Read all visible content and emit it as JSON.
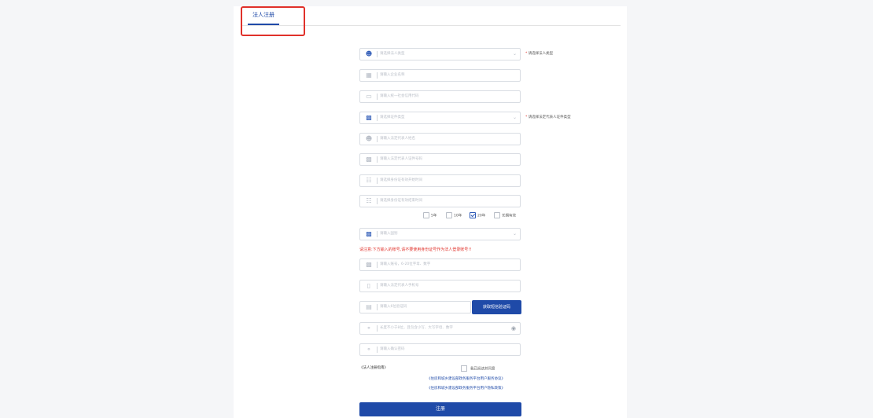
{
  "tab": {
    "label": "法人注册"
  },
  "fields": [
    {
      "placeholder": "请选择法人类型",
      "icon": "user-icon",
      "dropdown": true,
      "hint_req": "*",
      "hint": "请选择法人类型"
    },
    {
      "placeholder": "请输入企业名称",
      "icon": "building-icon"
    },
    {
      "placeholder": "请输入统一社会信用代码",
      "icon": "credit-card-icon"
    },
    {
      "placeholder": "请选择证件类型",
      "icon": "id-card-icon",
      "dropdown": true,
      "hint_req": "*",
      "hint": "请选择法定代表人证件类型"
    },
    {
      "placeholder": "请输入法定代表人姓名",
      "icon": "user-icon"
    },
    {
      "placeholder": "请输入法定代表人证件号码",
      "icon": "id-card-icon"
    },
    {
      "placeholder": "请选择身份证有效开始时间",
      "icon": "calendar-icon"
    },
    {
      "placeholder": "请选择身份证有效结束时间",
      "icon": "calendar-icon"
    }
  ],
  "validity_options": [
    {
      "label": "5年",
      "checked": false
    },
    {
      "label": "10年",
      "checked": false
    },
    {
      "label": "20年",
      "checked": true
    },
    {
      "label": "长期有效",
      "checked": false
    }
  ],
  "nationality": {
    "placeholder": "请输入国别",
    "icon": "id-card-icon"
  },
  "warning": "请注意:下方输入的账号,请不要使用身份证号作为法人登录账号!!",
  "account": {
    "placeholder": "请输入账号，6-20位字母、数字",
    "icon": "id-card-icon"
  },
  "phone": {
    "placeholder": "请输入法定代表人手机号",
    "icon": "phone-icon"
  },
  "sms": {
    "placeholder": "请输入6位验证码",
    "icon": "message-icon",
    "button": "获取短信验证码"
  },
  "password": {
    "placeholder": "长度不小于8位，且包含小写、大写字母、数字",
    "icon": "lock-icon"
  },
  "confirm_password": {
    "placeholder": "请输入确认密码",
    "icon": "lock-icon"
  },
  "guide": "《法人注册指南》",
  "agreement": {
    "label": "我已阅读并同意",
    "links": [
      "《住房和城乡建设部政务服务平台用户服务协议》",
      "《住房和城乡建设部政务服务平台用户隐私政策》"
    ]
  },
  "submit_label": "注册",
  "colors": {
    "primary": "#1f4aa8",
    "warning": "#e0312a",
    "highlight": "#e0312a"
  }
}
